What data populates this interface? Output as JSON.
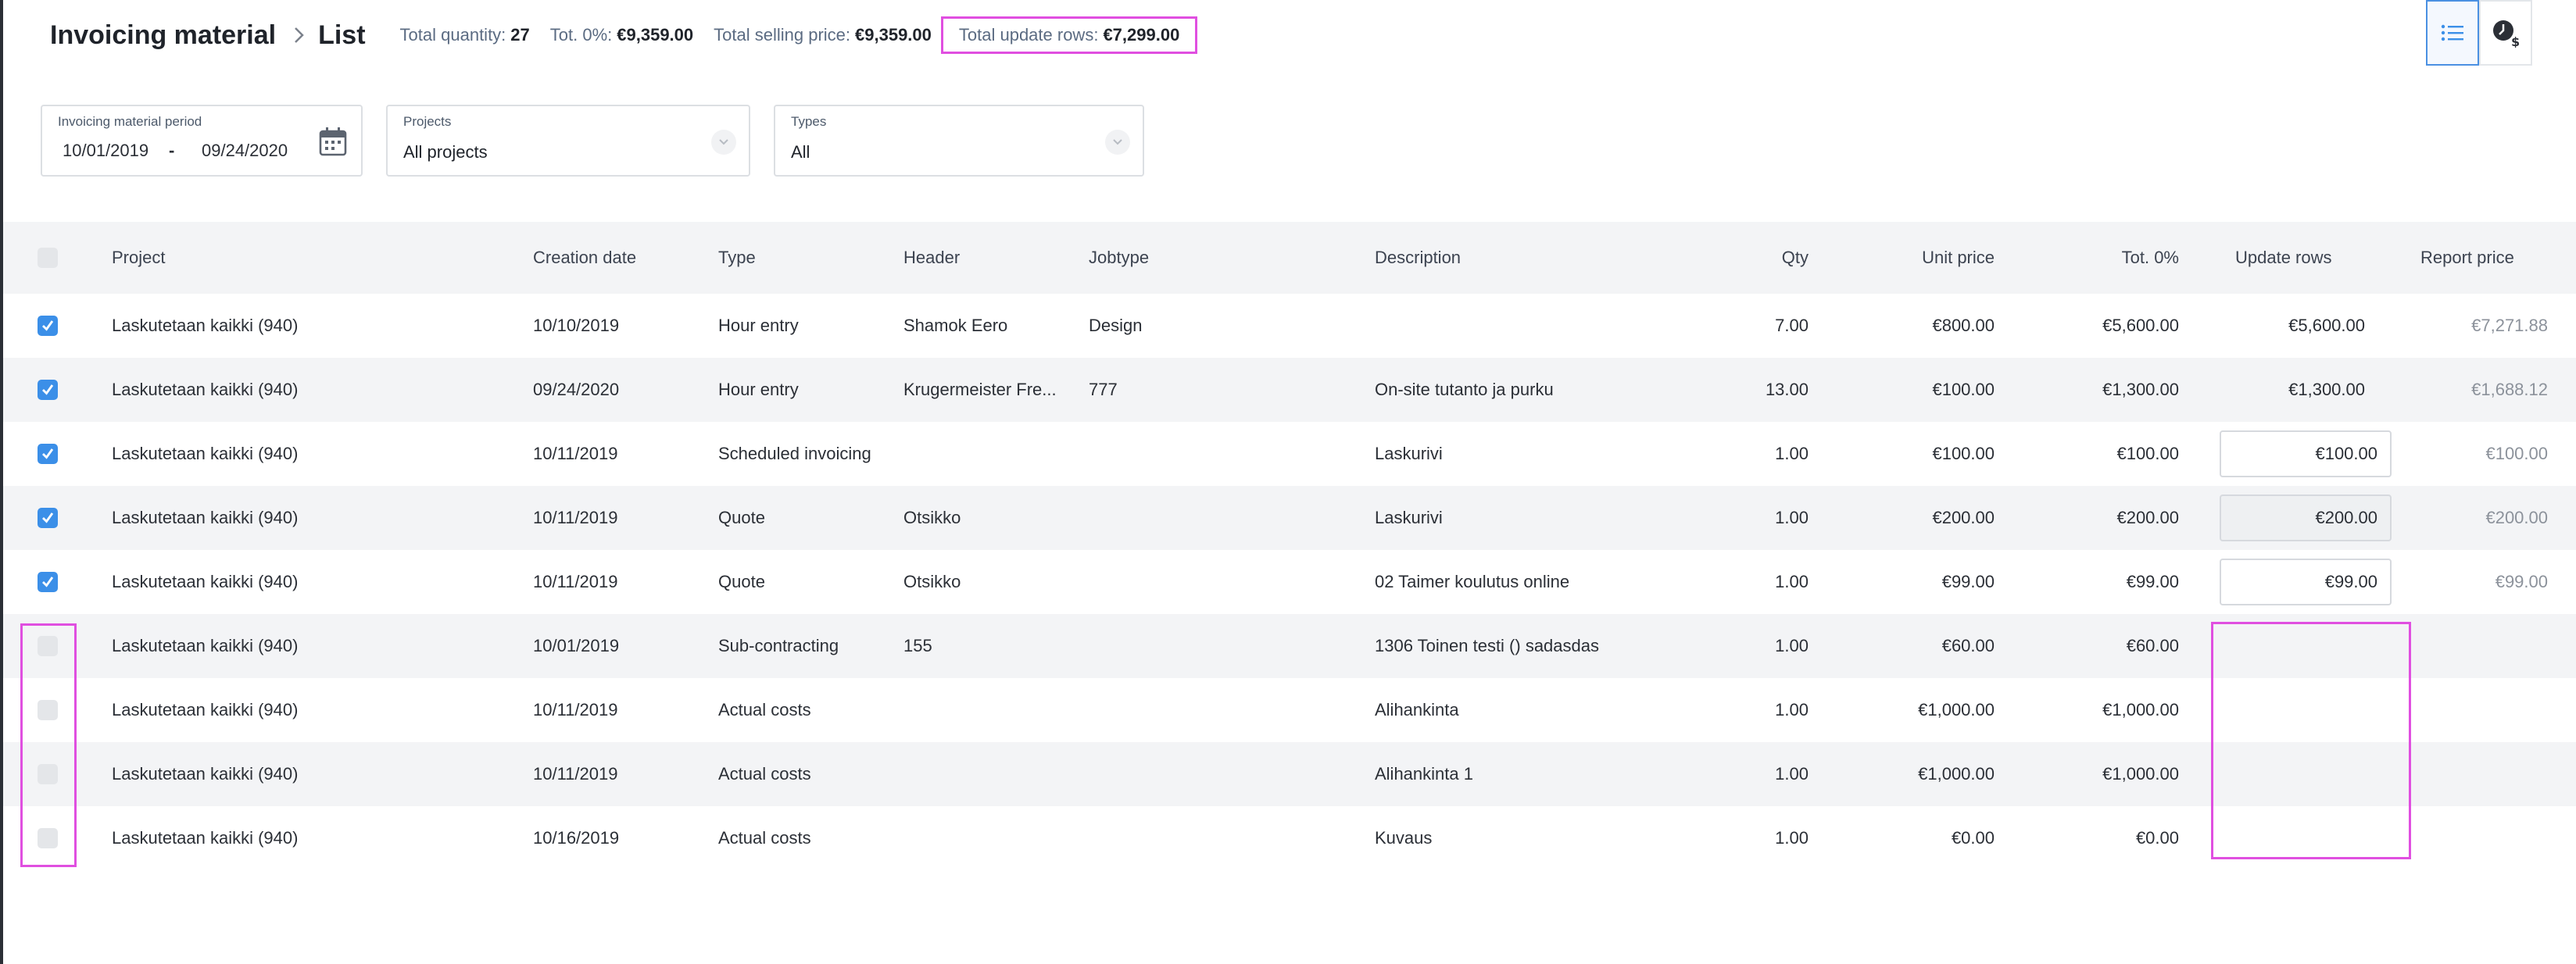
{
  "breadcrumb": {
    "title": "Invoicing material",
    "current": "List"
  },
  "summary": {
    "total_quantity_label": "Total quantity:",
    "total_quantity_value": "27",
    "tot_zero_label": "Tot. 0%:",
    "tot_zero_value": "€9,359.00",
    "total_selling_label": "Total selling price:",
    "total_selling_value": "€9,359.00",
    "total_update_label": "Total update rows:",
    "total_update_value": "€7,299.00"
  },
  "view_toggle": {
    "list_icon": "list-icon",
    "clock_dollar_icon": "clock-dollar-icon",
    "active": "list"
  },
  "filters": {
    "period_label": "Invoicing material period",
    "period_from": "10/01/2019",
    "period_dash": "-",
    "period_to": "09/24/2020",
    "projects_label": "Projects",
    "projects_value": "All projects",
    "types_label": "Types",
    "types_value": "All"
  },
  "table": {
    "columns": {
      "project": "Project",
      "creation_date": "Creation date",
      "type": "Type",
      "header": "Header",
      "jobtype": "Jobtype",
      "description": "Description",
      "qty": "Qty",
      "unit_price": "Unit price",
      "tot": "Tot. 0%",
      "update_rows": "Update rows",
      "report_price": "Report price"
    },
    "rows": [
      {
        "checked": true,
        "project": "Laskutetaan kaikki (940)",
        "date": "10/10/2019",
        "type": "Hour entry",
        "header": "Shamok Eero",
        "jobtype": "Design",
        "description": "",
        "qty": "7.00",
        "unit": "€800.00",
        "tot": "€5,600.00",
        "update": "€5,600.00",
        "update_mode": "text",
        "report": "€7,271.88"
      },
      {
        "checked": true,
        "project": "Laskutetaan kaikki (940)",
        "date": "09/24/2020",
        "type": "Hour entry",
        "header": "Krugermeister Fre...",
        "jobtype": "777",
        "description": "On-site tutanto ja purku",
        "qty": "13.00",
        "unit": "€100.00",
        "tot": "€1,300.00",
        "update": "€1,300.00",
        "update_mode": "text",
        "report": "€1,688.12"
      },
      {
        "checked": true,
        "project": "Laskutetaan kaikki (940)",
        "date": "10/11/2019",
        "type": "Scheduled invoicing",
        "header": "",
        "jobtype": "",
        "description": "Laskurivi",
        "qty": "1.00",
        "unit": "€100.00",
        "tot": "€100.00",
        "update": "€100.00",
        "update_mode": "input",
        "report": "€100.00"
      },
      {
        "checked": true,
        "project": "Laskutetaan kaikki (940)",
        "date": "10/11/2019",
        "type": "Quote",
        "header": "Otsikko",
        "jobtype": "",
        "description": "Laskurivi",
        "qty": "1.00",
        "unit": "€200.00",
        "tot": "€200.00",
        "update": "€200.00",
        "update_mode": "input-disabled",
        "report": "€200.00"
      },
      {
        "checked": true,
        "project": "Laskutetaan kaikki (940)",
        "date": "10/11/2019",
        "type": "Quote",
        "header": "Otsikko",
        "jobtype": "",
        "description": "02 Taimer koulutus online",
        "qty": "1.00",
        "unit": "€99.00",
        "tot": "€99.00",
        "update": "€99.00",
        "update_mode": "input",
        "report": "€99.00"
      },
      {
        "checked": false,
        "project": "Laskutetaan kaikki (940)",
        "date": "10/01/2019",
        "type": "Sub-contracting",
        "header": "155",
        "jobtype": "",
        "description": "1306 Toinen testi () sadasdas",
        "qty": "1.00",
        "unit": "€60.00",
        "tot": "€60.00",
        "update": "",
        "update_mode": "none",
        "report": ""
      },
      {
        "checked": false,
        "project": "Laskutetaan kaikki (940)",
        "date": "10/11/2019",
        "type": "Actual costs",
        "header": "",
        "jobtype": "",
        "description": "Alihankinta",
        "qty": "1.00",
        "unit": "€1,000.00",
        "tot": "€1,000.00",
        "update": "",
        "update_mode": "none",
        "report": ""
      },
      {
        "checked": false,
        "project": "Laskutetaan kaikki (940)",
        "date": "10/11/2019",
        "type": "Actual costs",
        "header": "",
        "jobtype": "",
        "description": "Alihankinta 1",
        "qty": "1.00",
        "unit": "€1,000.00",
        "tot": "€1,000.00",
        "update": "",
        "update_mode": "none",
        "report": ""
      },
      {
        "checked": false,
        "project": "Laskutetaan kaikki (940)",
        "date": "10/16/2019",
        "type": "Actual costs",
        "header": "",
        "jobtype": "",
        "description": "Kuvaus",
        "qty": "1.00",
        "unit": "€0.00",
        "tot": "€0.00",
        "update": "",
        "update_mode": "none",
        "report": ""
      }
    ]
  },
  "colors": {
    "accent": "#3b8fe8",
    "highlight": "#e04fe0",
    "row_alt": "#f3f4f6"
  }
}
